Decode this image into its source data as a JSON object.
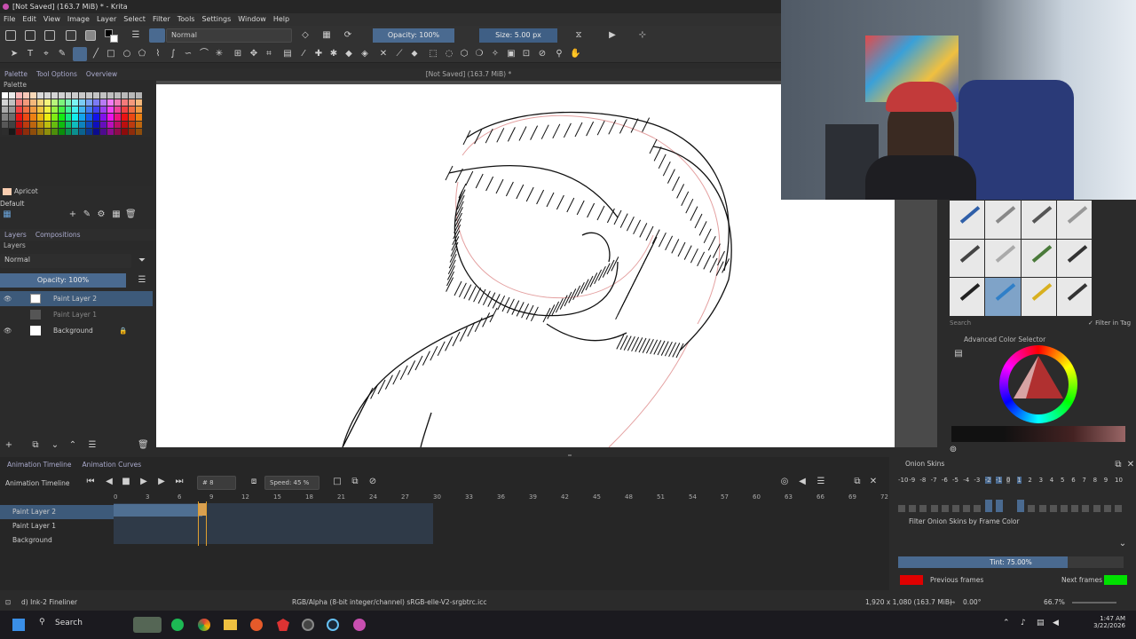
{
  "window": {
    "title": "[Not Saved]  (163.7 MiB) * - Krita",
    "canvas_title": "[Not Saved]  (163.7 MiB) *"
  },
  "menu": [
    "File",
    "Edit",
    "View",
    "Image",
    "Layer",
    "Select",
    "Filter",
    "Tools",
    "Settings",
    "Window",
    "Help"
  ],
  "toolbar": {
    "blend_mode": "Normal",
    "opacity": "Opacity: 100%",
    "size": "Size: 5.00 px"
  },
  "left_dock": {
    "tabs": [
      "Palette",
      "Tool Options",
      "Overview"
    ],
    "palette_title": "Palette",
    "color_name": "Apricot",
    "palette_set": "Default",
    "layer_tabs": [
      "Layers",
      "Compositions"
    ],
    "layers_title": "Layers",
    "layer_blend": "Normal",
    "layer_opacity": "Opacity:  100%",
    "layers": [
      {
        "name": "Paint Layer 2",
        "selected": true
      },
      {
        "name": "Paint Layer 1",
        "selected": false
      },
      {
        "name": "Background",
        "selected": false
      }
    ]
  },
  "right_dock": {
    "search_placeholder": "Search",
    "filter_in_tag": "Filter in Tag",
    "color_selector_title": "Advanced Color Selector"
  },
  "timeline": {
    "tabs": [
      "Animation Timeline",
      "Animation Curves"
    ],
    "title": "Animation Timeline",
    "frame": "8",
    "speed": "Speed: 45 %",
    "ruler": [
      "0",
      "3",
      "6",
      "9",
      "12",
      "15",
      "18",
      "21",
      "24",
      "27",
      "30",
      "33",
      "36",
      "39",
      "42",
      "45",
      "48",
      "51",
      "54",
      "57",
      "60",
      "63",
      "66",
      "69",
      "72"
    ],
    "layers": [
      "Paint Layer 2",
      "Paint Layer 1",
      "Background"
    ]
  },
  "onion": {
    "title": "Onion Skins",
    "numbers": [
      "-10",
      "-9",
      "-8",
      "-7",
      "-6",
      "-5",
      "-4",
      "-3",
      "-2",
      "-1",
      "0",
      "1",
      "2",
      "3",
      "4",
      "5",
      "6",
      "7",
      "8",
      "9",
      "10"
    ],
    "filter": "Filter Onion Skins by Frame Color",
    "tint": "Tint: 75.00%",
    "tint_fraction": 0.75,
    "previous": "Previous frames",
    "next": "Next frames",
    "prev_color": "#e00000",
    "next_color": "#00e000"
  },
  "status": {
    "brush": "d) Ink-2 Fineliner",
    "color_space": "RGB/Alpha (8-bit integer/channel)  sRGB-elle-V2-srgbtrc.icc",
    "dimensions": "1,920 x 1,080 (163.7 MiB)",
    "rotation": "0.00°",
    "zoom": "66.7%"
  },
  "taskbar": {
    "search": "Search",
    "time": "1:47 AM",
    "date": "3/22/2026"
  }
}
